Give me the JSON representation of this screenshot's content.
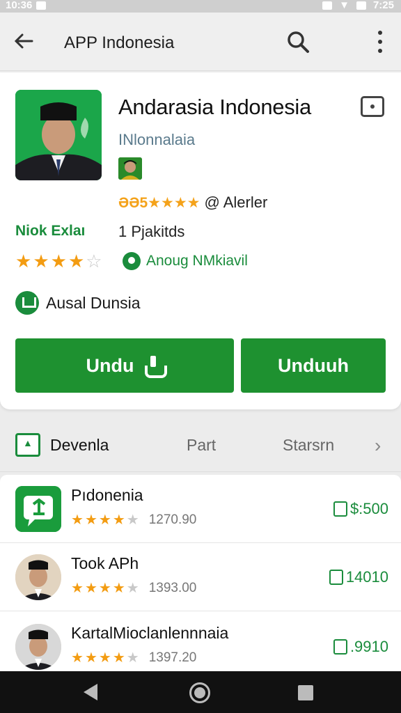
{
  "status_bar": {
    "time_left": "10:36",
    "time_right": "7:25"
  },
  "app_bar": {
    "title": "APP Indonesia"
  },
  "app_card": {
    "name": "Andarasia Indonesia",
    "subtitle": "INlonnalaia",
    "rating_text": "ƏƏ5★★★★",
    "alert_text": "@ Alerler",
    "left_label": "Niok Exlaı",
    "detail": "1 Pjakitds",
    "stars": 4,
    "badge_text": "Anoug NMkiavil",
    "info_text": "Ausal Dunsia",
    "primary_button": "Undu",
    "secondary_button": "Unduuh"
  },
  "tabs": [
    {
      "label": "Devenla"
    },
    {
      "label": "Part"
    },
    {
      "label": "Starsrn"
    }
  ],
  "list": [
    {
      "name": "Pıdonenia",
      "stars": 4,
      "count": "1270.90",
      "price": "$:500"
    },
    {
      "name": "Took APh",
      "stars": 4,
      "count": "1393.00",
      "price": "14010"
    },
    {
      "name": "KartalMioclanlennnaia",
      "stars": 4,
      "count": "1397.20",
      "price": ".9910"
    }
  ],
  "colors": {
    "accent": "#1e9130",
    "star": "#f39c12"
  },
  "icons": [
    "back-arrow-icon",
    "search-icon",
    "more-vert-icon",
    "bookmark-icon",
    "download-icon",
    "chevron-right-icon"
  ]
}
